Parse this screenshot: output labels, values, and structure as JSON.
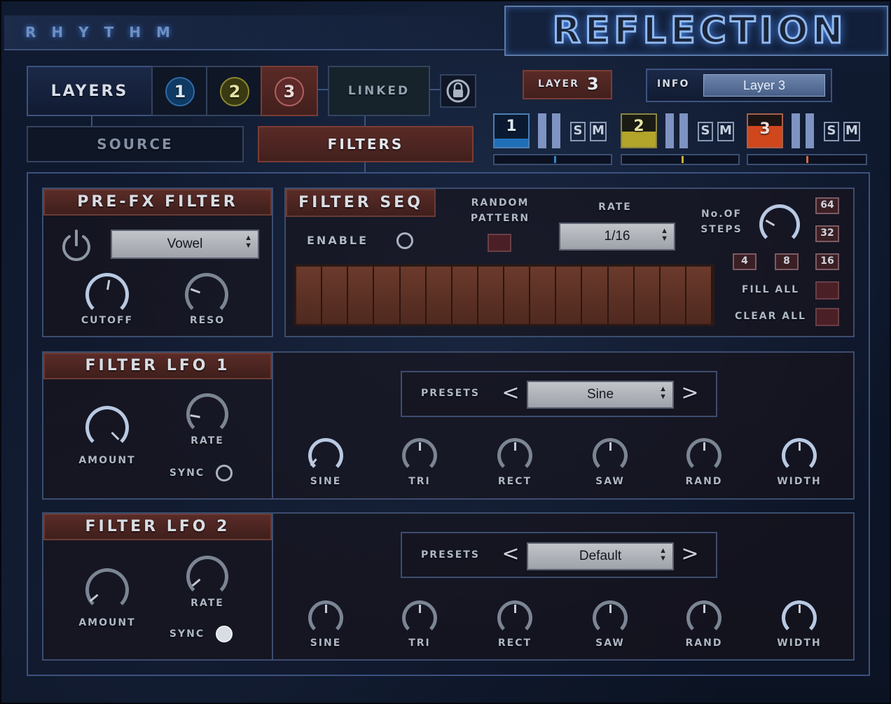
{
  "header": {
    "title_left": "RHYTHM",
    "logo": "REFLECTION"
  },
  "nav": {
    "layers_label": "LAYERS",
    "layer_buttons": [
      "1",
      "2",
      "3"
    ],
    "linked_label": "LINKED",
    "lock_icon": "lock-icon",
    "source_tab": "SOURCE",
    "filters_tab": "FILTERS"
  },
  "layer_indicator": {
    "label": "LAYER",
    "value": "3"
  },
  "info": {
    "label": "INFO",
    "value": "Layer 3"
  },
  "mixer": [
    {
      "num": "1",
      "solo": "S",
      "mute": "M",
      "color": "#1f6fb8",
      "level": 0.52
    },
    {
      "num": "2",
      "solo": "S",
      "mute": "M",
      "color": "#b3a52a",
      "level": 0.52
    },
    {
      "num": "3",
      "solo": "S",
      "mute": "M",
      "color": "#d0471e",
      "level": 0.5
    }
  ],
  "prefx": {
    "title": "PRE-FX FILTER",
    "type": "Vowel",
    "cutoff_label": "CUTOFF",
    "reso_label": "RESO"
  },
  "seq": {
    "title": "FILTER SEQ",
    "enable_label": "ENABLE",
    "random_label_1": "RANDOM",
    "random_label_2": "PATTERN",
    "rate_label": "RATE",
    "rate_value": "1/16",
    "steps_label_1": "No.OF",
    "steps_label_2": "STEPS",
    "step_options": [
      "64",
      "32",
      "4",
      "8",
      "16"
    ],
    "fill_label": "FILL ALL",
    "clear_label": "CLEAR ALL",
    "cells": 16
  },
  "lfo1": {
    "title": "FILTER LFO 1",
    "amount_label": "AMOUNT",
    "rate_label": "RATE",
    "sync_label": "SYNC",
    "presets_label": "PRESETS",
    "preset": "Sine",
    "prev": "<",
    "next": ">",
    "waves": [
      "SINE",
      "TRI",
      "RECT",
      "SAW",
      "RAND",
      "WIDTH"
    ]
  },
  "lfo2": {
    "title": "FILTER LFO 2",
    "amount_label": "AMOUNT",
    "rate_label": "RATE",
    "sync_label": "SYNC",
    "presets_label": "PRESETS",
    "preset": "Default",
    "prev": "<",
    "next": ">",
    "waves": [
      "SINE",
      "TRI",
      "RECT",
      "SAW",
      "RAND",
      "WIDTH"
    ]
  }
}
